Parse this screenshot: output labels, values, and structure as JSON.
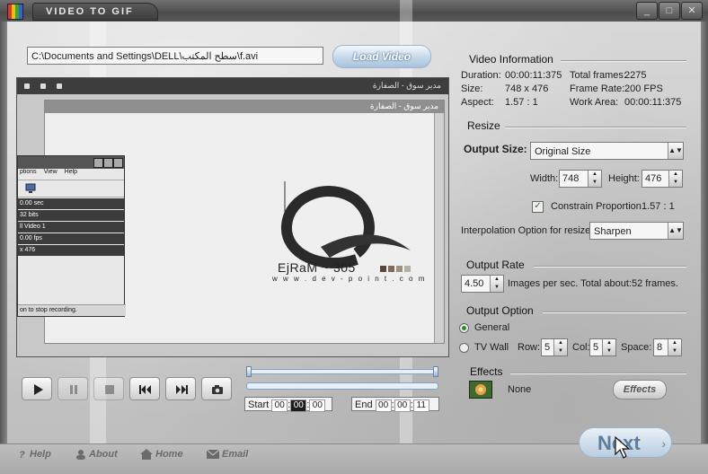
{
  "window": {
    "title": "VIDEO TO GIF",
    "controls": {
      "minimize": "_",
      "maximize": "□",
      "close": "✕"
    }
  },
  "source": {
    "path": "C:\\Documents and Settings\\DELL\\سطح المكتب\\f.avi",
    "load_button": "Load Video"
  },
  "preview": {
    "outer_caption": "مدير سوق - الصفارة",
    "inner_caption": "مدير سوق - الصفارة",
    "logo_name": "EjRaM ~ 305",
    "logo_url": "w w w . d e v - p o i n t . c o m",
    "logo_colors": [
      "#5a4638",
      "#7d6a5a",
      "#9d9086",
      "#b7b0a9"
    ],
    "mini_window": {
      "menu": [
        "ptions",
        "View",
        "Help"
      ],
      "rows": [
        "0.00 sec",
        "32 bits",
        "ll Video 1",
        "0.00 fps",
        "x 476"
      ],
      "footer": "on to stop recording."
    }
  },
  "playback": {
    "controls": [
      {
        "name": "play-button",
        "icon": "play-icon",
        "enabled": true
      },
      {
        "name": "pause-button",
        "icon": "pause-icon",
        "enabled": false
      },
      {
        "name": "stop-button",
        "icon": "stop-icon",
        "enabled": false
      },
      {
        "name": "rewind-button",
        "icon": "rewind-icon",
        "enabled": true
      },
      {
        "name": "forward-button",
        "icon": "fast-forward-icon",
        "enabled": true
      },
      {
        "name": "snapshot-button",
        "icon": "camera-icon",
        "enabled": true
      }
    ],
    "seek_position": 0,
    "start": {
      "label": "Start",
      "h": "00",
      "m": "00",
      "s": "00"
    },
    "end": {
      "label": "End",
      "h": "00",
      "m": "00",
      "s": "11"
    }
  },
  "video_info": {
    "title": "Video Information",
    "duration_label": "Duration:",
    "duration": "00:00:11:375",
    "total_frames_label": "Total frames:",
    "total_frames": "2275",
    "size_label": "Size:",
    "size": "748 x 476",
    "frame_rate_label": "Frame Rate:",
    "frame_rate": "200 FPS",
    "aspect_label": "Aspect:",
    "aspect": "1.57 : 1",
    "work_area_label": "Work Area:",
    "work_area": "00:00:11:375"
  },
  "resize": {
    "title": "Resize",
    "output_size_label": "Output Size:",
    "output_size": "Original Size",
    "width_label": "Width:",
    "width": "748",
    "height_label": "Height:",
    "height": "476",
    "constrain_label": "Constrain Proportion",
    "constrain_checked": true,
    "constrain_ratio": "1.57 : 1",
    "interp_label": "Interpolation Option for resize:",
    "interp_value": "Sharpen"
  },
  "output_rate": {
    "title": "Output Rate",
    "value": "4.50",
    "desc": "Images per sec. Total about:52 frames."
  },
  "output_option": {
    "title": "Output Option",
    "general_label": "General",
    "general_checked": true,
    "tv_wall_label": "TV Wall",
    "tv_wall_checked": false,
    "row_label": "Row:",
    "row": "5",
    "col_label": "Col:",
    "col": "5",
    "space_label": "Space:",
    "space": "8"
  },
  "effects": {
    "title": "Effects",
    "value": "None",
    "button": "Effects"
  },
  "bottom": {
    "help": "Help",
    "about": "About",
    "home": "Home",
    "email": "Email",
    "next": "Next"
  }
}
